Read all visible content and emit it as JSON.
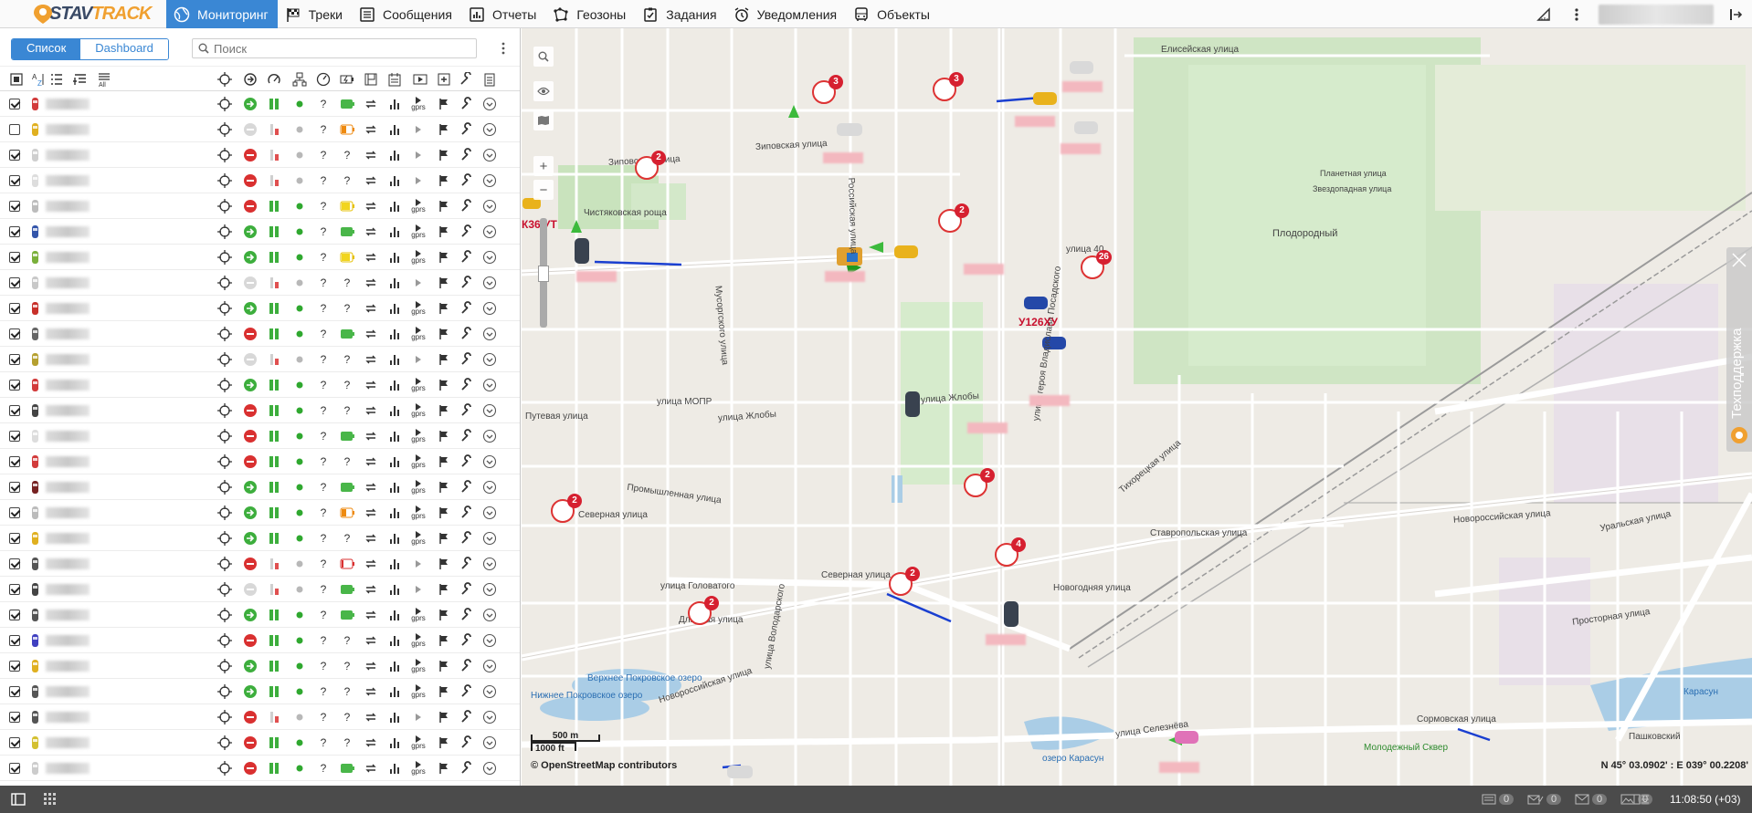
{
  "app": {
    "logo_text_1": "STAV",
    "logo_text_2": "TRACK"
  },
  "nav": [
    {
      "label": "Мониторинг",
      "icon": "globe-icon",
      "active": true
    },
    {
      "label": "Треки",
      "icon": "checkered-flag-icon"
    },
    {
      "label": "Сообщения",
      "icon": "message-list-icon"
    },
    {
      "label": "Отчеты",
      "icon": "report-chart-icon"
    },
    {
      "label": "Геозоны",
      "icon": "geofence-icon"
    },
    {
      "label": "Задания",
      "icon": "task-check-icon"
    },
    {
      "label": "Уведомления",
      "icon": "alarm-clock-icon"
    },
    {
      "label": "Объекты",
      "icon": "bus-icon"
    }
  ],
  "left": {
    "tab_list": "Список",
    "tab_dashboard": "Dashboard",
    "search_placeholder": "Поиск",
    "sort_all_label": "All"
  },
  "rows": [
    {
      "checked": true,
      "car": "#d23b3b",
      "st": "green",
      "bat": "full",
      "q1": "?",
      "q2": "?"
    },
    {
      "checked": false,
      "car": "#e0b020",
      "st": "grey",
      "bat": "orange",
      "q1": "?",
      "q2": ""
    },
    {
      "checked": true,
      "car": "#cfcfcf",
      "st": "grey",
      "bat": "",
      "q1": "?",
      "q2": "?"
    },
    {
      "checked": true,
      "car": "#dddddd",
      "st": "grey",
      "bat": "",
      "q1": "?",
      "q2": "?"
    },
    {
      "checked": true,
      "car": "#bcbcbc",
      "st": "green",
      "bat": "yellow",
      "q1": "?",
      "q2": ""
    },
    {
      "checked": true,
      "car": "#3355aa",
      "st": "green",
      "bat": "full",
      "q1": "?",
      "q2": ""
    },
    {
      "checked": true,
      "car": "#7ab03a",
      "st": "green",
      "bat": "yellow",
      "q1": "?",
      "q2": ""
    },
    {
      "checked": true,
      "car": "#c8c8c8",
      "st": "grey",
      "bat": "",
      "q1": "?",
      "q2": "?"
    },
    {
      "checked": true,
      "car": "#c8302a",
      "st": "green",
      "bat": "",
      "q1": "?",
      "q2": "?"
    },
    {
      "checked": true,
      "car": "#666666",
      "st": "green",
      "bat": "full",
      "q1": "?",
      "q2": ""
    },
    {
      "checked": true,
      "car": "#b5a030",
      "st": "grey",
      "bat": "",
      "q1": "?",
      "q2": "?"
    },
    {
      "checked": true,
      "car": "#d23b3b",
      "st": "green",
      "bat": "",
      "q1": "?",
      "q2": "?"
    },
    {
      "checked": true,
      "car": "#444444",
      "st": "green",
      "bat": "",
      "q1": "?",
      "q2": "?"
    },
    {
      "checked": true,
      "car": "#dddddd",
      "st": "green",
      "bat": "full",
      "q1": "?",
      "q2": ""
    },
    {
      "checked": true,
      "car": "#d23b3b",
      "st": "green",
      "bat": "",
      "q1": "?",
      "q2": "?"
    },
    {
      "checked": true,
      "car": "#772222",
      "st": "green",
      "bat": "full",
      "q1": "?",
      "q2": ""
    },
    {
      "checked": true,
      "car": "#bbbbbb",
      "st": "green",
      "bat": "orange",
      "q1": "?",
      "q2": ""
    },
    {
      "checked": true,
      "car": "#e0b020",
      "st": "green",
      "bat": "",
      "q1": "?",
      "q2": "?"
    },
    {
      "checked": true,
      "car": "#555555",
      "st": "grey",
      "bat": "red",
      "q1": "?",
      "q2": ""
    },
    {
      "checked": true,
      "car": "#444444",
      "st": "grey",
      "bat": "full",
      "q1": "?",
      "q2": ""
    },
    {
      "checked": true,
      "car": "#555555",
      "st": "green",
      "bat": "full",
      "q1": "?",
      "q2": ""
    },
    {
      "checked": true,
      "car": "#4040c0",
      "st": "green",
      "bat": "",
      "q1": "?",
      "q2": "?"
    },
    {
      "checked": true,
      "car": "#e0b020",
      "st": "green",
      "bat": "",
      "q1": "?",
      "q2": "?"
    },
    {
      "checked": true,
      "car": "#555555",
      "st": "green",
      "bat": "",
      "q1": "?",
      "q2": "?"
    },
    {
      "checked": true,
      "car": "#555555",
      "st": "grey",
      "bat": "",
      "q1": "?",
      "q2": "?"
    },
    {
      "checked": true,
      "car": "#d4c030",
      "st": "green",
      "bat": "",
      "q1": "?",
      "q2": "?"
    },
    {
      "checked": true,
      "car": "#cccccc",
      "st": "green",
      "bat": "full",
      "q1": "?",
      "q2": ""
    }
  ],
  "gprs_label": "gprs",
  "map": {
    "streets": [
      {
        "t": "Елисейская улица"
      },
      {
        "t": "Зиповская улица"
      },
      {
        "t": "Зиповская улица"
      },
      {
        "t": "Чистяковская роща"
      },
      {
        "t": "Плодородный"
      },
      {
        "t": "Планетная улица"
      },
      {
        "t": "Звездопадная улица"
      },
      {
        "t": "улица 40"
      },
      {
        "t": "улица МОПР"
      },
      {
        "t": "улица Жлобы"
      },
      {
        "t": "улица Жлобы"
      },
      {
        "t": "Промышленная улица"
      },
      {
        "t": "Северная улица"
      },
      {
        "t": "Северная улица"
      },
      {
        "t": "улица Головатого"
      },
      {
        "t": "Длинная улица"
      },
      {
        "t": "Новороссийская улица"
      },
      {
        "t": "Новороссийская улица"
      },
      {
        "t": "Ставропольская улица"
      },
      {
        "t": "Уральская улица"
      },
      {
        "t": "Тихорецкая улица"
      },
      {
        "t": "Новогодняя улица"
      },
      {
        "t": "Верхнее Покровское озеро"
      },
      {
        "t": "Нижнее Покровское озеро"
      },
      {
        "t": "озеро Карасун"
      },
      {
        "t": "Карасун"
      },
      {
        "t": "Молодежный Сквер"
      },
      {
        "t": "Пашковский"
      },
      {
        "t": "Просторная улица"
      },
      {
        "t": "Сормовская улица"
      },
      {
        "t": "улица Селезнёва"
      },
      {
        "t": "улица Володарского"
      },
      {
        "t": "Российская улица"
      },
      {
        "t": "улица героя Владислава Посадского"
      },
      {
        "t": "Путевая улица"
      },
      {
        "t": "Мусоргского улица"
      }
    ],
    "plates": [
      "У126ХУ",
      "К36 УТ"
    ],
    "clusters": [
      "3",
      "3",
      "2",
      "2",
      "26",
      "2",
      "2",
      "2",
      "4",
      "2",
      "2"
    ],
    "scale_m": "500 m",
    "scale_ft": "1000 ft",
    "attribution": "© OpenStreetMap contributors",
    "coords": "N 45° 03.0902' : E 039° 00.2208'",
    "support": "Техподдержка",
    "zoom_in": "+",
    "zoom_out": "−"
  },
  "footer": {
    "counts": [
      "0",
      "0",
      "0",
      "0"
    ],
    "clock": "11:08:50 (+03)"
  }
}
